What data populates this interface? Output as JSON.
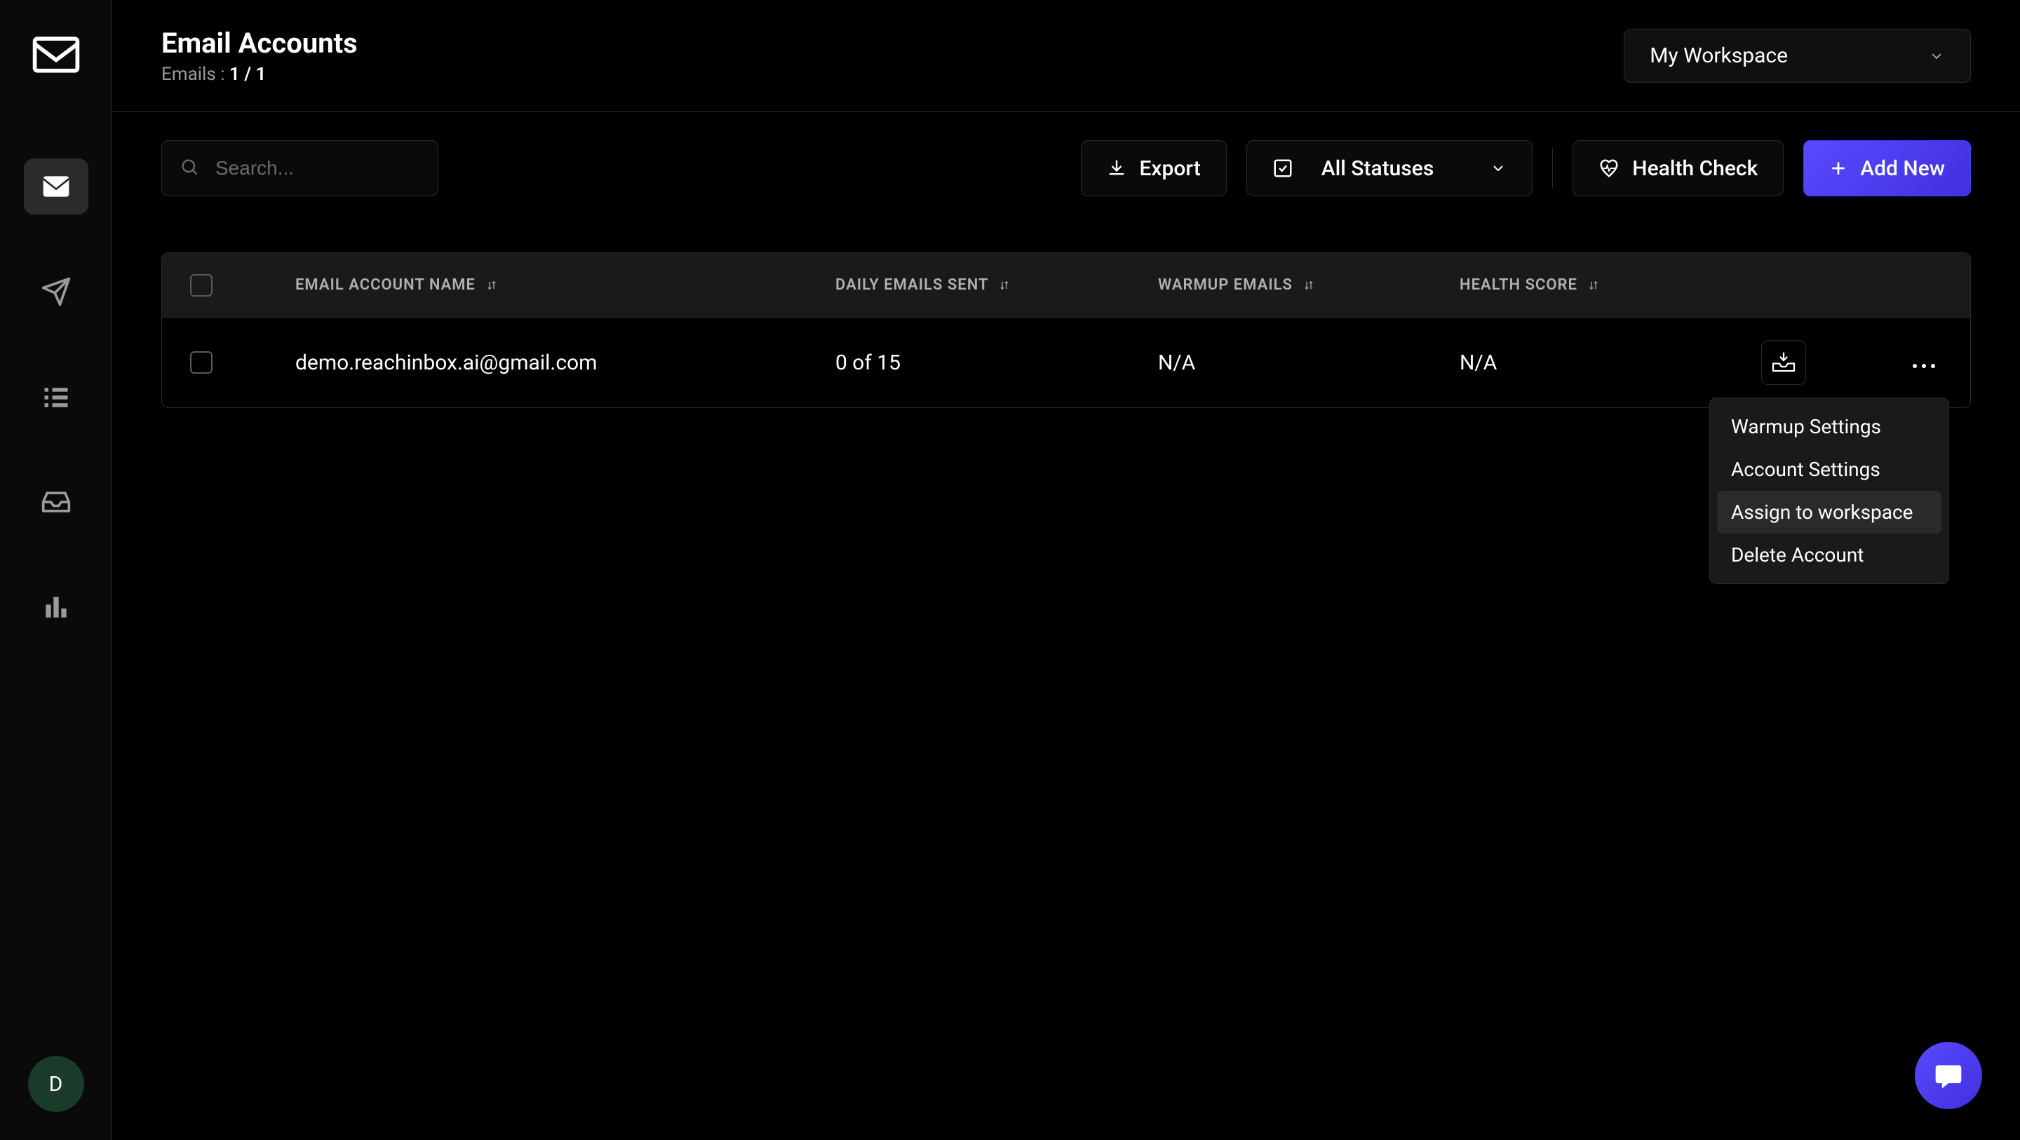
{
  "header": {
    "title": "Email Accounts",
    "subtitle_label": "Emails :",
    "subtitle_count": "1 / 1",
    "workspace_label": "My Workspace"
  },
  "toolbar": {
    "search_placeholder": "Search...",
    "export_label": "Export",
    "status_filter_label": "All Statuses",
    "health_check_label": "Health Check",
    "add_new_label": "Add New"
  },
  "table": {
    "columns": {
      "account_name": "EMAIL ACCOUNT NAME",
      "daily_sent": "DAILY EMAILS SENT",
      "warmup": "WARMUP EMAILS",
      "health_score": "HEALTH SCORE"
    },
    "rows": [
      {
        "account_name": "demo.reachinbox.ai@gmail.com",
        "daily_sent": "0 of 15",
        "warmup": "N/A",
        "health_score": "N/A"
      }
    ]
  },
  "dropdown": {
    "items": [
      "Warmup Settings",
      "Account Settings",
      "Assign to workspace",
      "Delete Account"
    ],
    "hover_index": 2
  },
  "avatar": {
    "initial": "D"
  },
  "colors": {
    "primary": "#4a3aff",
    "bg": "#000000",
    "border": "#2a2a2a"
  }
}
